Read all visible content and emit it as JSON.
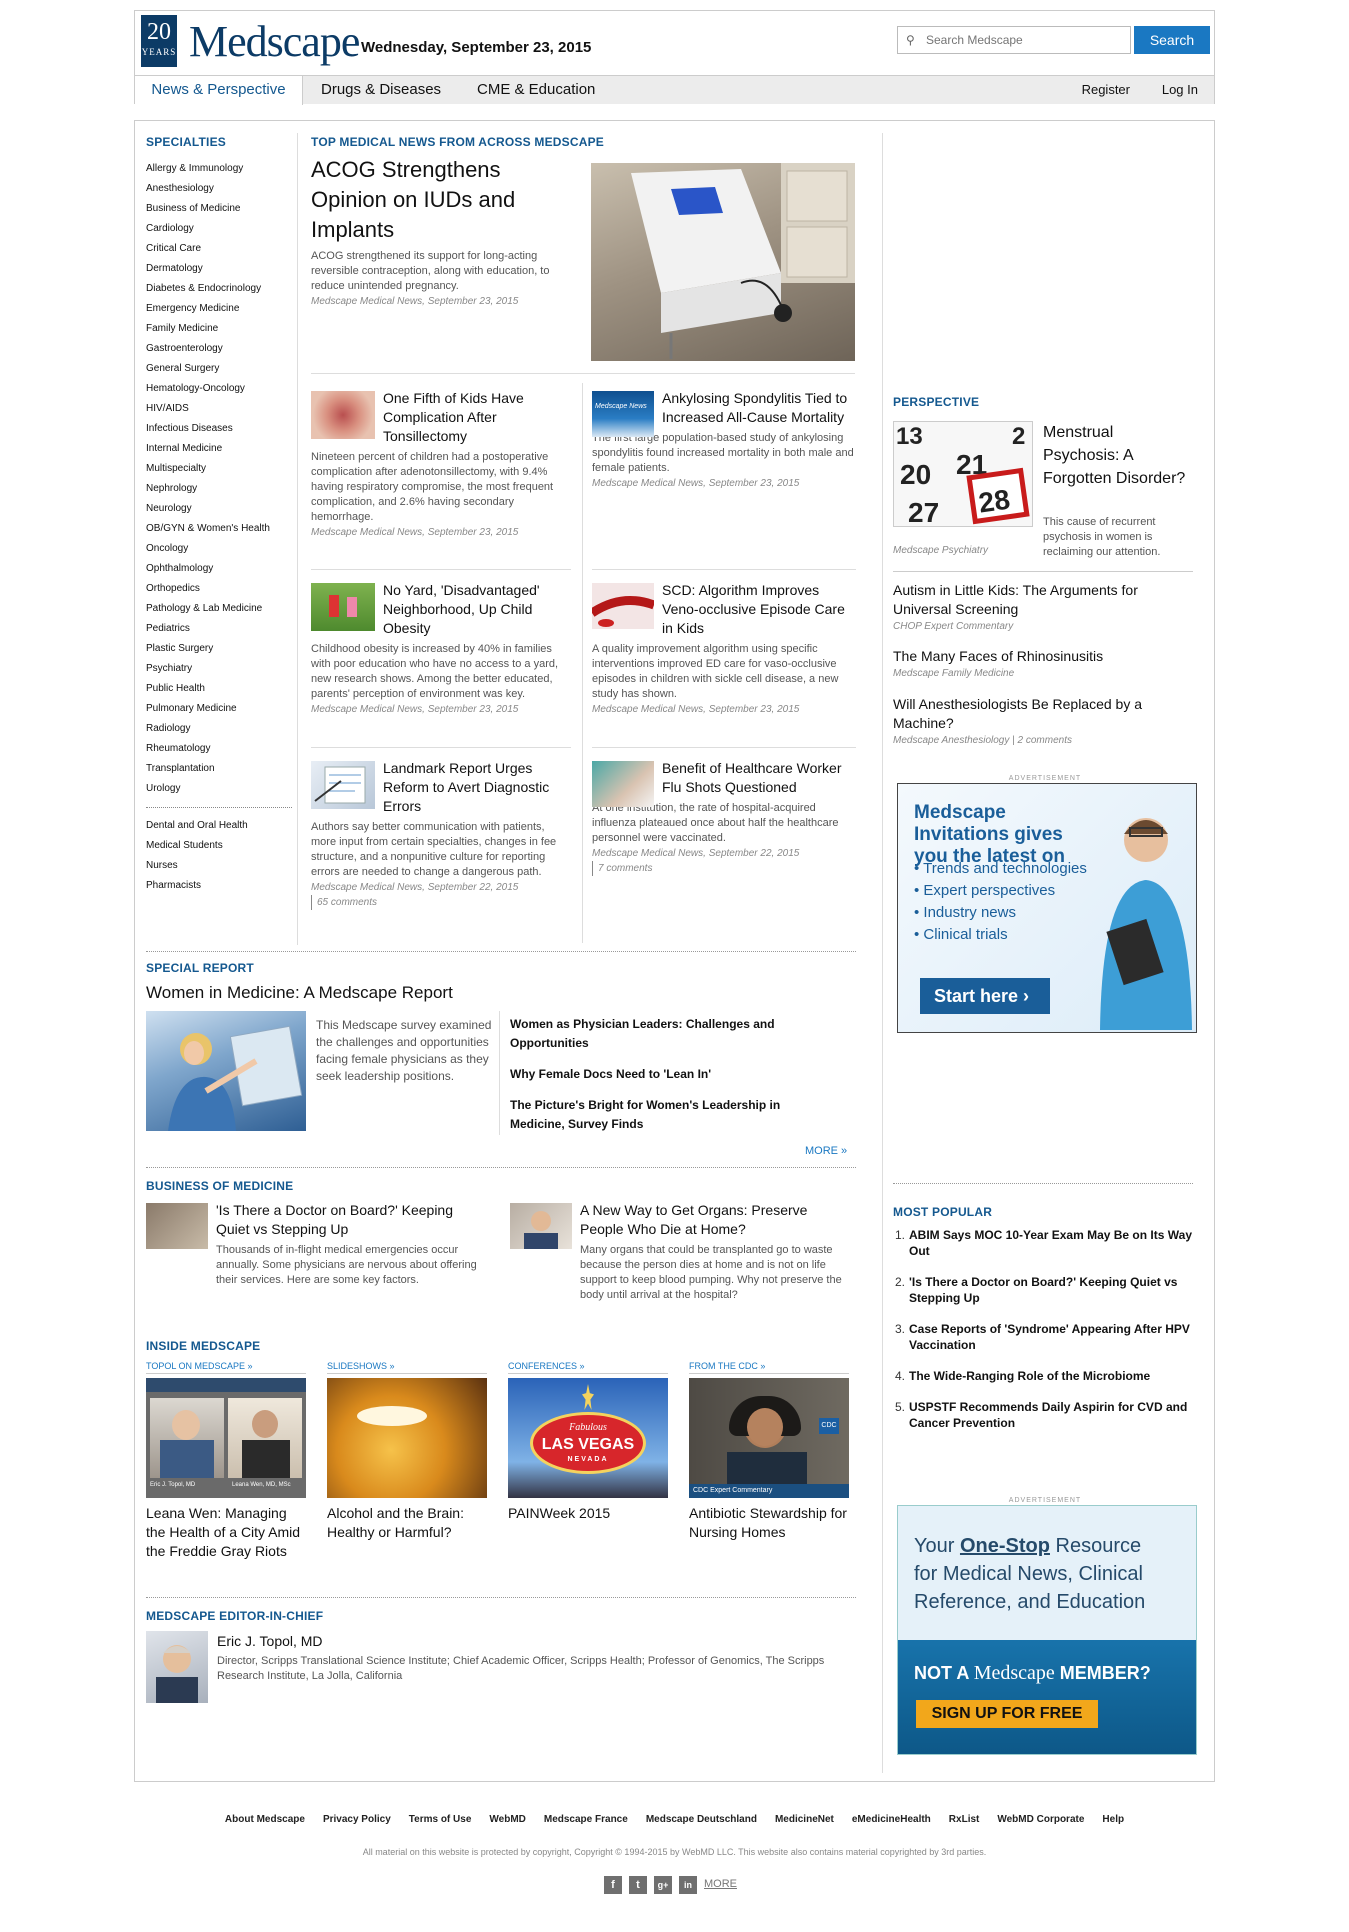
{
  "header": {
    "logo_years": "20",
    "logo_years_label": "YEARS",
    "logo_text": "Medscape",
    "date": "Wednesday, September 23, 2015",
    "search_placeholder": "Search Medscape",
    "search_button": "Search"
  },
  "nav": {
    "tabs": [
      "News & Perspective",
      "Drugs & Diseases",
      "CME & Education"
    ],
    "register": "Register",
    "login": "Log In"
  },
  "sidebar": {
    "title": "SPECIALTIES",
    "items": [
      "Allergy & Immunology",
      "Anesthesiology",
      "Business of Medicine",
      "Cardiology",
      "Critical Care",
      "Dermatology",
      "Diabetes & Endocrinology",
      "Emergency Medicine",
      "Family Medicine",
      "Gastroenterology",
      "General Surgery",
      "Hematology-Oncology",
      "HIV/AIDS",
      "Infectious Diseases",
      "Internal Medicine",
      "Multispecialty",
      "Nephrology",
      "Neurology",
      "OB/GYN & Women's Health",
      "Oncology",
      "Ophthalmology",
      "Orthopedics",
      "Pathology & Lab Medicine",
      "Pediatrics",
      "Plastic Surgery",
      "Psychiatry",
      "Public Health",
      "Pulmonary Medicine",
      "Radiology",
      "Rheumatology",
      "Transplantation",
      "Urology"
    ],
    "extra": [
      "Dental and Oral Health",
      "Medical Students",
      "Nurses",
      "Pharmacists"
    ]
  },
  "top_news": {
    "title": "TOP MEDICAL NEWS FROM ACROSS MEDSCAPE",
    "lead": {
      "headline": "ACOG Strengthens Opinion on IUDs and Implants",
      "dek": "ACOG strengthened its support for long-acting reversible contraception, along with education, to reduce unintended pregnancy.",
      "meta": "Medscape Medical News, September 23, 2015"
    },
    "stories": [
      {
        "headline": "One Fifth of Kids Have Complication After Tonsillectomy",
        "dek": "Nineteen percent of children had a postoperative complication after adenotonsillectomy, with 9.4% having respiratory compromise, the most frequent complication, and 2.6% having secondary hemorrhage.",
        "meta": "Medscape Medical News, September 23, 2015",
        "comments": ""
      },
      {
        "headline": "Ankylosing Spondylitis Tied to Increased All-Cause Mortality",
        "dek": "The first large population-based study of ankylosing spondylitis found increased mortality in both male and female patients.",
        "meta": "Medscape Medical News, September 23, 2015",
        "comments": ""
      },
      {
        "headline": "No Yard, 'Disadvantaged' Neighborhood, Up Child Obesity",
        "dek": "Childhood obesity is increased by 40% in families with poor education who have no access to a yard, new research shows. Among the better educated, parents' perception of environment was key.",
        "meta": "Medscape Medical News, September 23, 2015",
        "comments": ""
      },
      {
        "headline": "SCD: Algorithm Improves Veno-occlusive Episode Care in Kids",
        "dek": "A quality improvement algorithm using specific interventions improved ED care for vaso-occlusive episodes in children with sickle cell disease, a new study has shown.",
        "meta": "Medscape Medical News, September 23, 2015",
        "comments": ""
      },
      {
        "headline": "Landmark Report Urges Reform to Avert Diagnostic Errors",
        "dek": "Authors say better communication with patients, more input from certain specialties, changes in fee structure, and a nonpunitive culture for reporting errors are needed to change a dangerous path.",
        "meta": "Medscape Medical News, September 22, 2015",
        "comments": "65 comments"
      },
      {
        "headline": "Benefit of Healthcare Worker Flu Shots Questioned",
        "dek": "At one institution, the rate of hospital-acquired influenza plateaued once about half the healthcare personnel were vaccinated.",
        "meta": "Medscape Medical News, September 22, 2015",
        "comments": "7 comments"
      }
    ],
    "thumb_label_news": "Medscape News"
  },
  "special_report": {
    "title": "SPECIAL REPORT",
    "headline": "Women in Medicine: A Medscape Report",
    "dek": "This Medscape survey examined the challenges and opportunities facing female physicians as they seek leadership positions.",
    "links": [
      "Women as Physician Leaders: Challenges and Opportunities",
      "Why Female Docs Need to 'Lean In'",
      "The Picture's Bright for Women's Leadership in Medicine, Survey Finds"
    ],
    "more": "MORE »"
  },
  "business": {
    "title": "BUSINESS OF MEDICINE",
    "stories": [
      {
        "headline": "'Is There a Doctor on Board?' Keeping Quiet vs Stepping Up",
        "dek": "Thousands of in-flight medical emergencies occur annually. Some physicians are nervous about offering their services. Here are some key factors."
      },
      {
        "headline": "A New Way to Get Organs: Preserve People Who Die at Home?",
        "dek": "Many organs that could be transplanted go to waste because the person dies at home and is not on life support to keep blood pumping. Why not preserve the body until arrival at the hospital?"
      }
    ]
  },
  "inside": {
    "title": "INSIDE MEDSCAPE",
    "items": [
      {
        "label": "TOPOL ON MEDSCAPE »",
        "headline": "Leana Wen: Managing the Health of a City Amid the Freddie Gray Riots",
        "caption_left": "Eric J. Topol, MD",
        "caption_right": "Leana Wen, MD, MSc"
      },
      {
        "label": "SLIDESHOWS »",
        "headline": "Alcohol and the Brain: Healthy or Harmful?"
      },
      {
        "label": "CONFERENCES »",
        "headline": "PAINWeek 2015",
        "sign_top": "Fabulous",
        "sign_main": "LAS VEGAS",
        "sign_sub": "NEVADA"
      },
      {
        "label": "FROM THE CDC »",
        "headline": "Antibiotic Stewardship for Nursing Homes",
        "caption": "CDC Expert Commentary",
        "badge": "CDC"
      }
    ]
  },
  "editor": {
    "title": "MEDSCAPE EDITOR-IN-CHIEF",
    "name": "Eric J. Topol, MD",
    "bio": "Director, Scripps Translational Science Institute; Chief Academic Officer, Scripps Health; Professor of Genomics, The Scripps Research Institute, La Jolla, California"
  },
  "perspective": {
    "title": "PERSPECTIVE",
    "lead": {
      "headline": "Menstrual Psychosis: A Forgotten Disorder?",
      "dek": "This cause of recurrent psychosis in women is reclaiming our attention.",
      "meta": "Medscape Psychiatry",
      "cal": [
        "13",
        "2",
        "20",
        "21",
        "27",
        "28"
      ]
    },
    "items": [
      {
        "headline": "Autism in Little Kids: The Arguments for Universal Screening",
        "meta": "CHOP Expert Commentary",
        "comments": ""
      },
      {
        "headline": "The Many Faces of Rhinosinusitis",
        "meta": "Medscape Family Medicine",
        "comments": ""
      },
      {
        "headline": "Will Anesthesiologists Be Replaced by a Machine?",
        "meta": "Medscape Anesthesiology",
        "comments": "2 comments"
      }
    ]
  },
  "ad1": {
    "label": "ADVERTISEMENT",
    "title": "Medscape Invitations gives you the latest on",
    "bullets": [
      "Trends and technologies",
      "Expert perspectives",
      "Industry news",
      "Clinical trials"
    ],
    "cta": "Start here"
  },
  "most_popular": {
    "title": "MOST POPULAR",
    "items": [
      "ABIM Says MOC 10-Year Exam May Be on Its Way Out",
      "'Is There a Doctor on Board?' Keeping Quiet vs Stepping Up",
      "Case Reports of 'Syndrome' Appearing After HPV Vaccination",
      "The Wide-Ranging Role of the Microbiome",
      "USPSTF Recommends Daily Aspirin for CVD and Cancer Prevention"
    ]
  },
  "ad2": {
    "label": "ADVERTISEMENT",
    "line1a": "Your ",
    "line1b": "One-Stop",
    "line1c": " Resource",
    "line2": "for Medical News, Clinical",
    "line3": "Reference, and Education",
    "not_a": "NOT A",
    "brand": "Medscape",
    "member": "MEMBER?",
    "cta": "SIGN UP FOR FREE"
  },
  "footer": {
    "links": [
      "About Medscape",
      "Privacy Policy",
      "Terms of Use",
      "WebMD",
      "Medscape France",
      "Medscape Deutschland",
      "MedicineNet",
      "eMedicineHealth",
      "RxList",
      "WebMD Corporate",
      "Help"
    ],
    "copyright": "All material on this website is protected by copyright, Copyright © 1994-2015 by WebMD LLC. This website also contains material copyrighted by 3rd parties.",
    "social": [
      "f",
      "t",
      "g+",
      "in"
    ],
    "more": "MORE"
  }
}
